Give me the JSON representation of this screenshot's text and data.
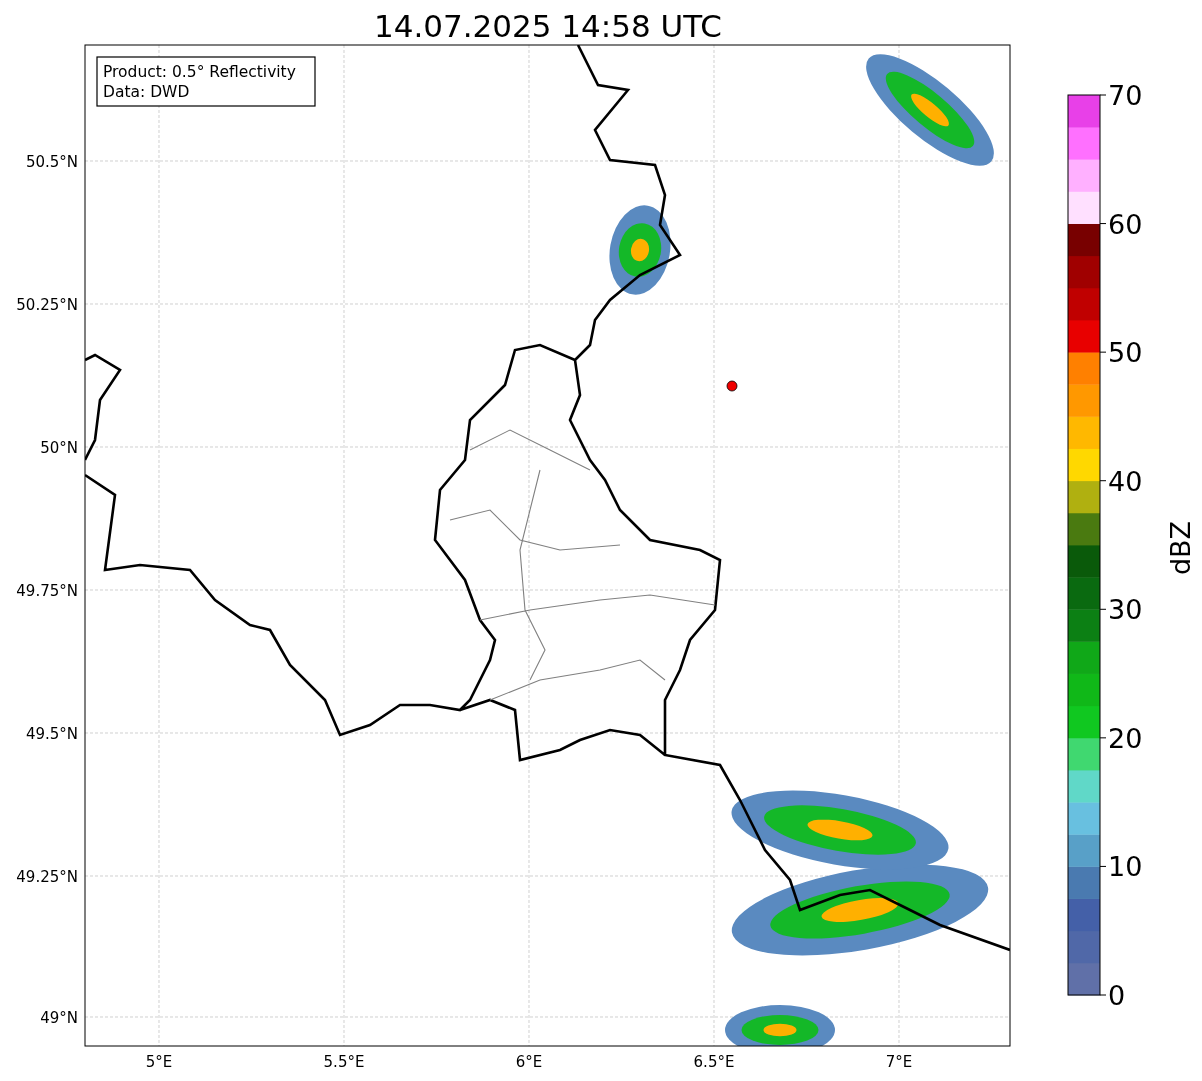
{
  "title": "14.07.2025 14:58 UTC",
  "info_box": [
    "Product: 0.5° Reflectivity",
    "Data: DWD"
  ],
  "map": {
    "x_ticks": [
      "5°E",
      "5.5°E",
      "6°E",
      "6.5°E",
      "7°E"
    ],
    "y_ticks": [
      "50.5°N",
      "50.25°N",
      "50°N",
      "49.75°N",
      "49.5°N",
      "49.25°N",
      "49°N"
    ]
  },
  "colorbar": {
    "label": "dBZ",
    "ticks": [
      "70",
      "60",
      "50",
      "40",
      "30",
      "20",
      "10",
      "0"
    ],
    "segments": [
      {
        "color": "#6070a8"
      },
      {
        "color": "#5068a8"
      },
      {
        "color": "#4460a8"
      },
      {
        "color": "#4a7ab0"
      },
      {
        "color": "#58a0c8"
      },
      {
        "color": "#68c0e0"
      },
      {
        "color": "#60d8c8"
      },
      {
        "color": "#40d870"
      },
      {
        "color": "#10c820"
      },
      {
        "color": "#10b818"
      },
      {
        "color": "#10a818"
      },
      {
        "color": "#0c8014"
      },
      {
        "color": "#0a6a10"
      },
      {
        "color": "#0a5a0a"
      },
      {
        "color": "#4a7a10"
      },
      {
        "color": "#b0b010"
      },
      {
        "color": "#ffd800"
      },
      {
        "color": "#ffb800"
      },
      {
        "color": "#ff9800"
      },
      {
        "color": "#ff8000"
      },
      {
        "color": "#e80000"
      },
      {
        "color": "#c00000"
      },
      {
        "color": "#a00000"
      },
      {
        "color": "#780000"
      },
      {
        "color": "#ffe0ff"
      },
      {
        "color": "#ffb0ff"
      },
      {
        "color": "#ff70ff"
      },
      {
        "color": "#e840e8"
      }
    ]
  }
}
